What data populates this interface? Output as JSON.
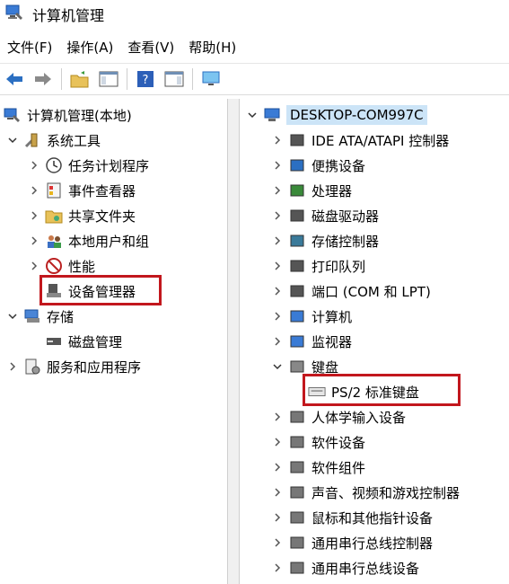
{
  "window": {
    "title": "计算机管理"
  },
  "menu": [
    "文件(F)",
    "操作(A)",
    "查看(V)",
    "帮助(H)"
  ],
  "toolbar": {
    "buttons": [
      "back-arrow-icon",
      "forward-arrow-icon",
      "up-folder-icon",
      "show-hide-tree-icon",
      "help-icon",
      "action-pane-icon",
      "monitor-icon"
    ]
  },
  "left_tree": {
    "root": "计算机管理(本地)",
    "system_tools": "系统工具",
    "items": [
      "任务计划程序",
      "事件查看器",
      "共享文件夹",
      "本地用户和组",
      "性能",
      "设备管理器"
    ],
    "storage": "存储",
    "disk_mgmt": "磁盘管理",
    "services": "服务和应用程序"
  },
  "right_tree": {
    "root": "DESKTOP-COM997C",
    "categories": [
      "IDE ATA/ATAPI 控制器",
      "便携设备",
      "处理器",
      "磁盘驱动器",
      "存储控制器",
      "打印队列",
      "端口 (COM 和 LPT)",
      "计算机",
      "监视器",
      "键盘"
    ],
    "keyboard_child": "PS/2 标准键盘",
    "categories_after": [
      "人体学输入设备",
      "软件设备",
      "软件组件",
      "声音、视频和游戏控制器",
      "鼠标和其他指针设备",
      "通用串行总线控制器",
      "通用串行总线设备"
    ]
  },
  "colors": {
    "highlight_box": "#c2171d",
    "selection": "#cce4f7"
  }
}
